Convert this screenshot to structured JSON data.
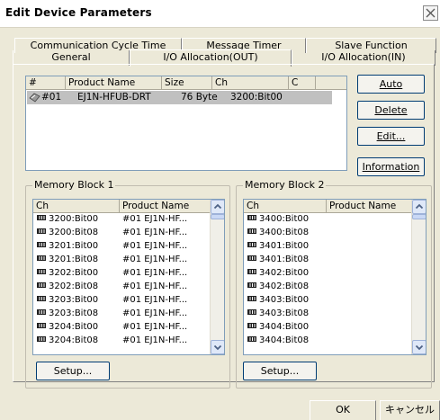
{
  "window": {
    "title": "Edit Device Parameters",
    "close_icon": "close-icon"
  },
  "tabs_back": [
    "Communication Cycle Time",
    "Message Timer",
    "Slave Function"
  ],
  "tabs_front": [
    "General",
    "I/O Allocation(OUT)",
    "I/O Allocation(IN)"
  ],
  "active_tab": "I/O Allocation(OUT)",
  "device_list": {
    "columns": [
      "#",
      "Product Name",
      "Size",
      "Ch",
      "C"
    ],
    "rows": [
      {
        "num": "#01",
        "product": "EJ1N-HFUB-DRT",
        "size": "76 Byte",
        "ch": "3200:Bit00",
        "c": ""
      }
    ],
    "row_icon": "device-icon"
  },
  "side_buttons": {
    "auto": "Auto",
    "delete": "Delete",
    "edit": "Edit...",
    "information": "Information"
  },
  "memory_block_1": {
    "label": "Memory Block 1",
    "columns": [
      "Ch",
      "Product Name"
    ],
    "rows": [
      {
        "ch": "3200:Bit00",
        "product": "#01 EJ1N-HF..."
      },
      {
        "ch": "3200:Bit08",
        "product": "#01 EJ1N-HF..."
      },
      {
        "ch": "3201:Bit00",
        "product": "#01 EJ1N-HF..."
      },
      {
        "ch": "3201:Bit08",
        "product": "#01 EJ1N-HF..."
      },
      {
        "ch": "3202:Bit00",
        "product": "#01 EJ1N-HF..."
      },
      {
        "ch": "3202:Bit08",
        "product": "#01 EJ1N-HF..."
      },
      {
        "ch": "3203:Bit00",
        "product": "#01 EJ1N-HF..."
      },
      {
        "ch": "3203:Bit08",
        "product": "#01 EJ1N-HF..."
      },
      {
        "ch": "3204:Bit00",
        "product": "#01 EJ1N-HF..."
      },
      {
        "ch": "3204:Bit08",
        "product": "#01 EJ1N-HF..."
      }
    ],
    "setup": "Setup..."
  },
  "memory_block_2": {
    "label": "Memory Block 2",
    "columns": [
      "Ch",
      "Product Name"
    ],
    "rows": [
      {
        "ch": "3400:Bit00",
        "product": ""
      },
      {
        "ch": "3400:Bit08",
        "product": ""
      },
      {
        "ch": "3401:Bit00",
        "product": ""
      },
      {
        "ch": "3401:Bit08",
        "product": ""
      },
      {
        "ch": "3402:Bit00",
        "product": ""
      },
      {
        "ch": "3402:Bit08",
        "product": ""
      },
      {
        "ch": "3403:Bit00",
        "product": ""
      },
      {
        "ch": "3403:Bit08",
        "product": ""
      },
      {
        "ch": "3404:Bit00",
        "product": ""
      },
      {
        "ch": "3404:Bit08",
        "product": ""
      }
    ],
    "setup": "Setup..."
  },
  "footer": {
    "ok": "OK",
    "cancel": "キャンセル"
  },
  "colors": {
    "dialog_bg": "#ece9d8",
    "selection": "#c0c0c0"
  }
}
